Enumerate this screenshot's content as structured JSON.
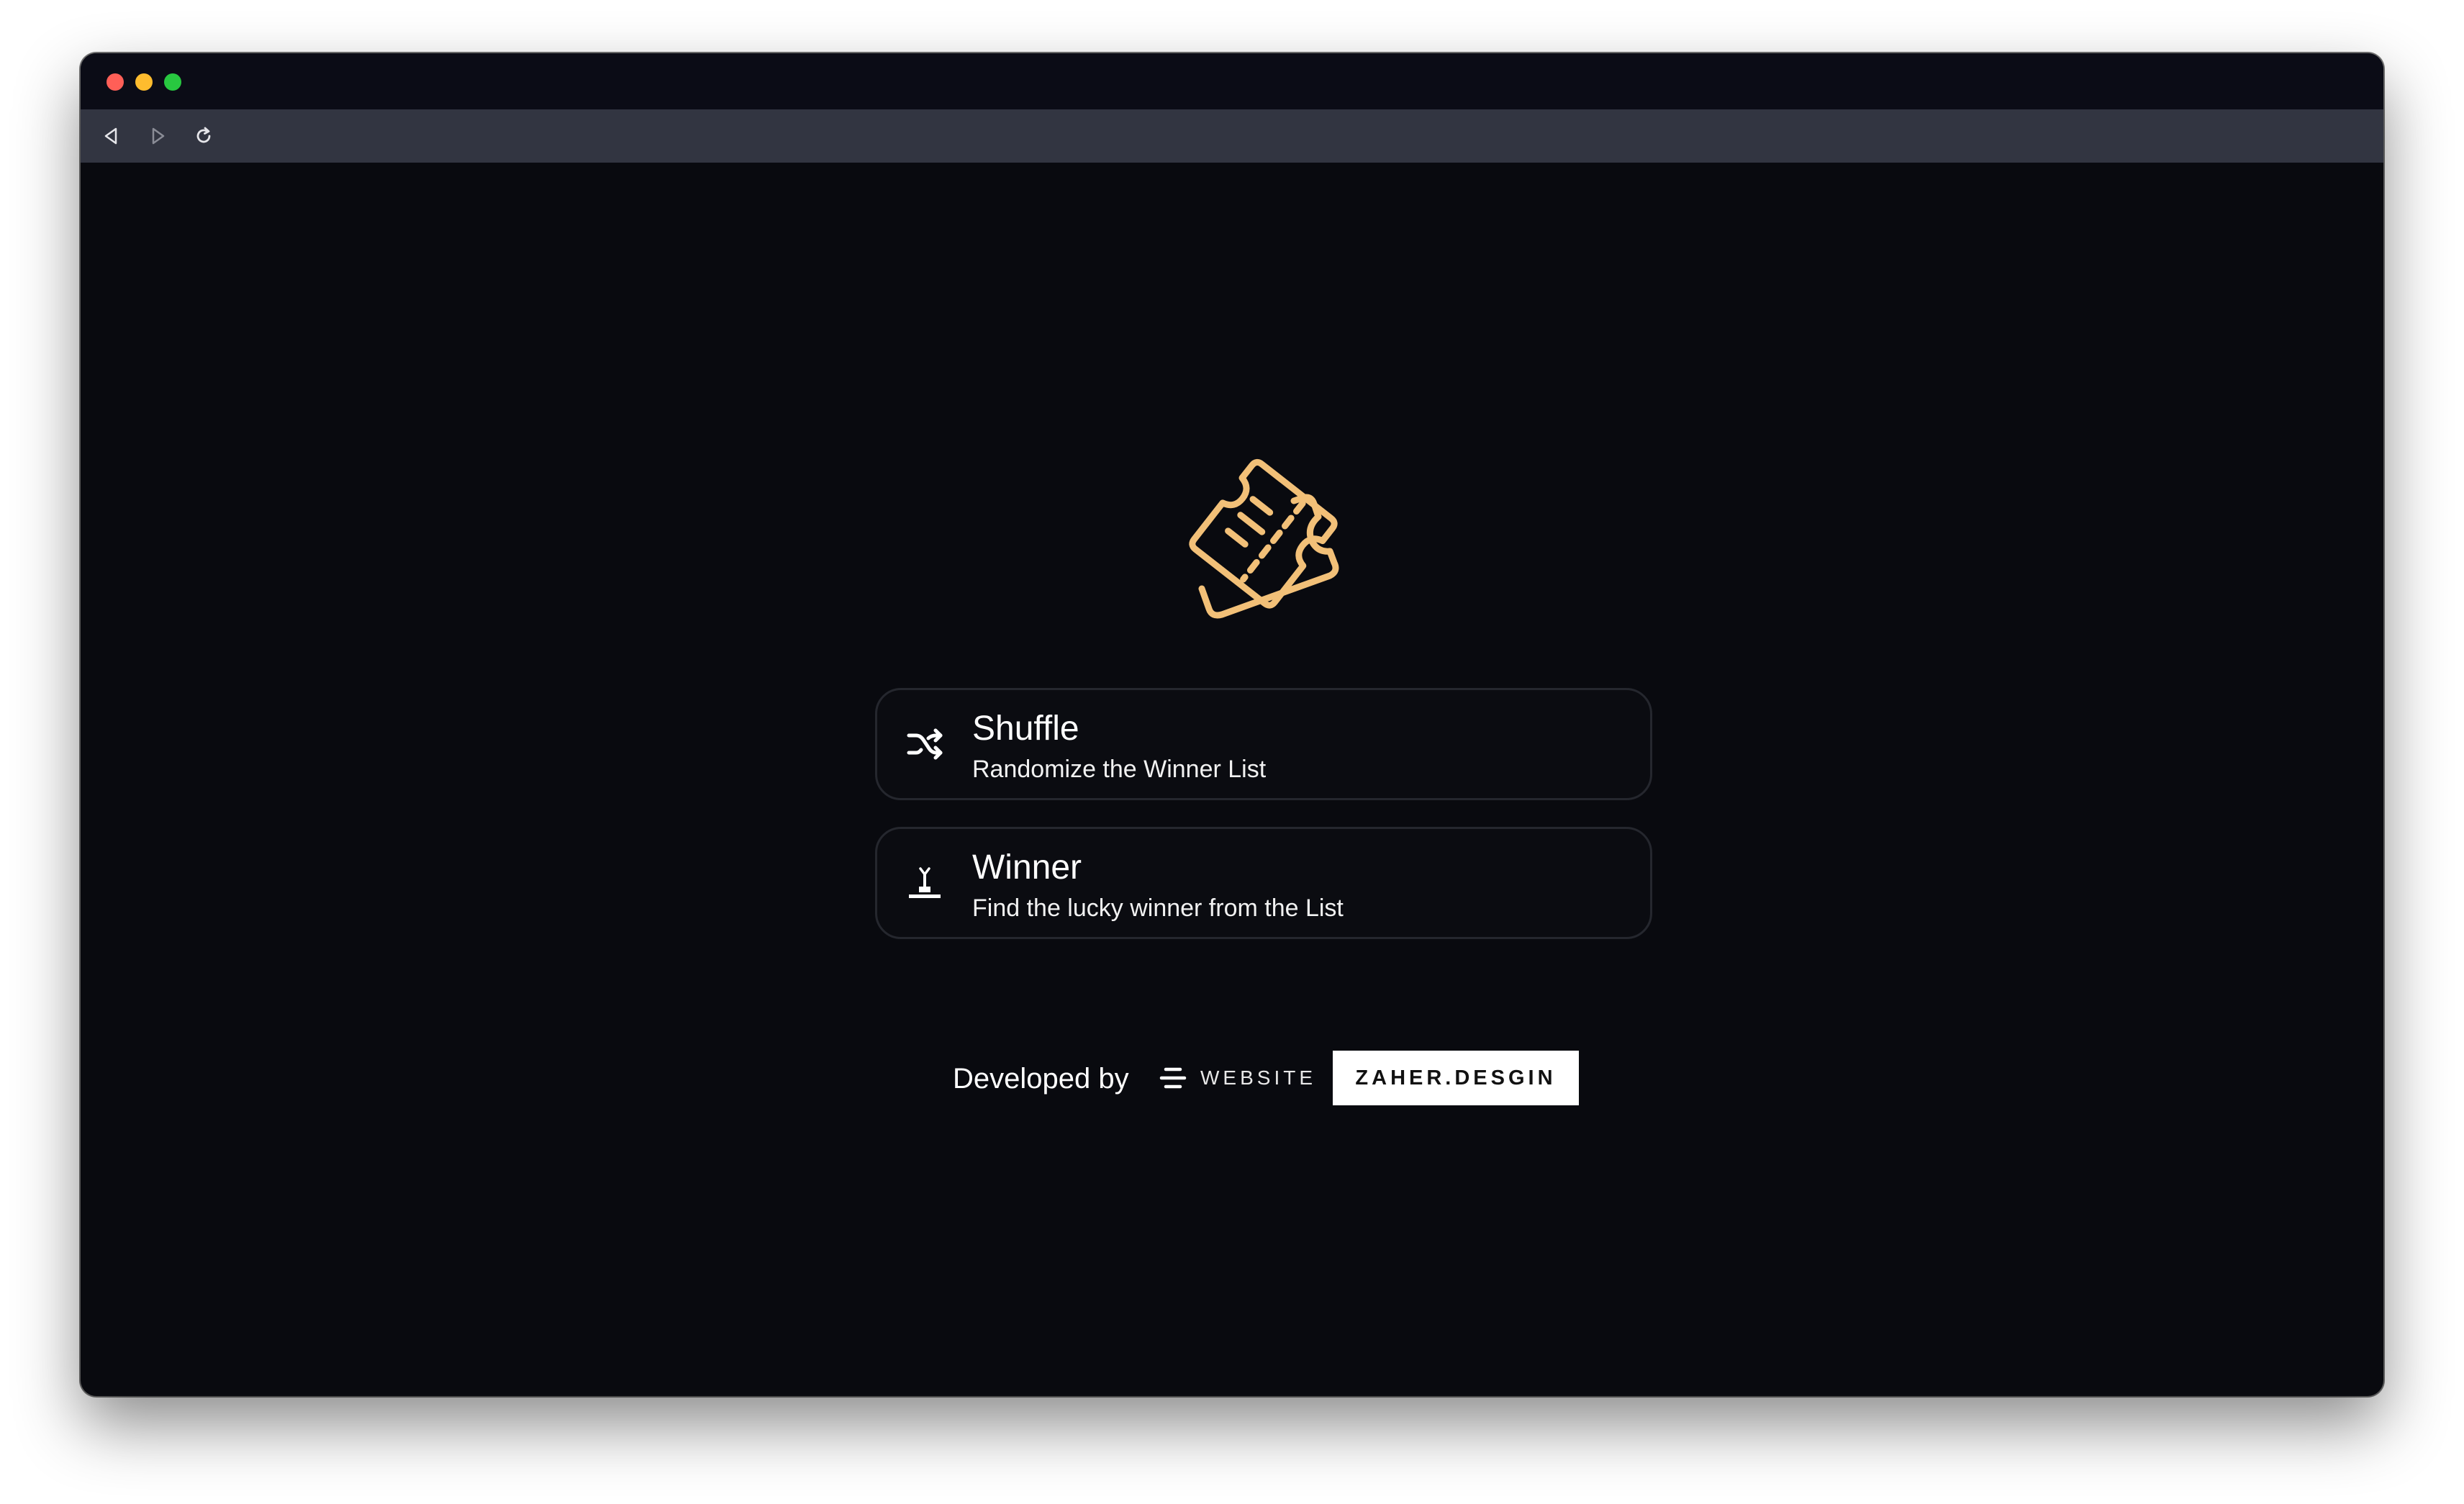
{
  "window": {
    "traffic_lights": {
      "close": "#ff5f57",
      "minimize": "#febc2e",
      "maximize": "#28c840"
    }
  },
  "toolbar": {
    "back_icon": "triangle-left",
    "forward_icon": "triangle-right",
    "reload_icon": "circular-arrow"
  },
  "app": {
    "logo_icon": "tickets-icon",
    "accent_color": "#f2c078",
    "actions": [
      {
        "title": "Shuffle",
        "subtitle": "Randomize the Winner List",
        "icon": "shuffle-icon"
      },
      {
        "title": "Winner",
        "subtitle": "Find the lucky winner from the List",
        "icon": "joystick-icon"
      }
    ]
  },
  "footer": {
    "developed_by": "Developed by",
    "website_label": "WEBSITE",
    "brand": "ZAHER.DESGIN"
  }
}
